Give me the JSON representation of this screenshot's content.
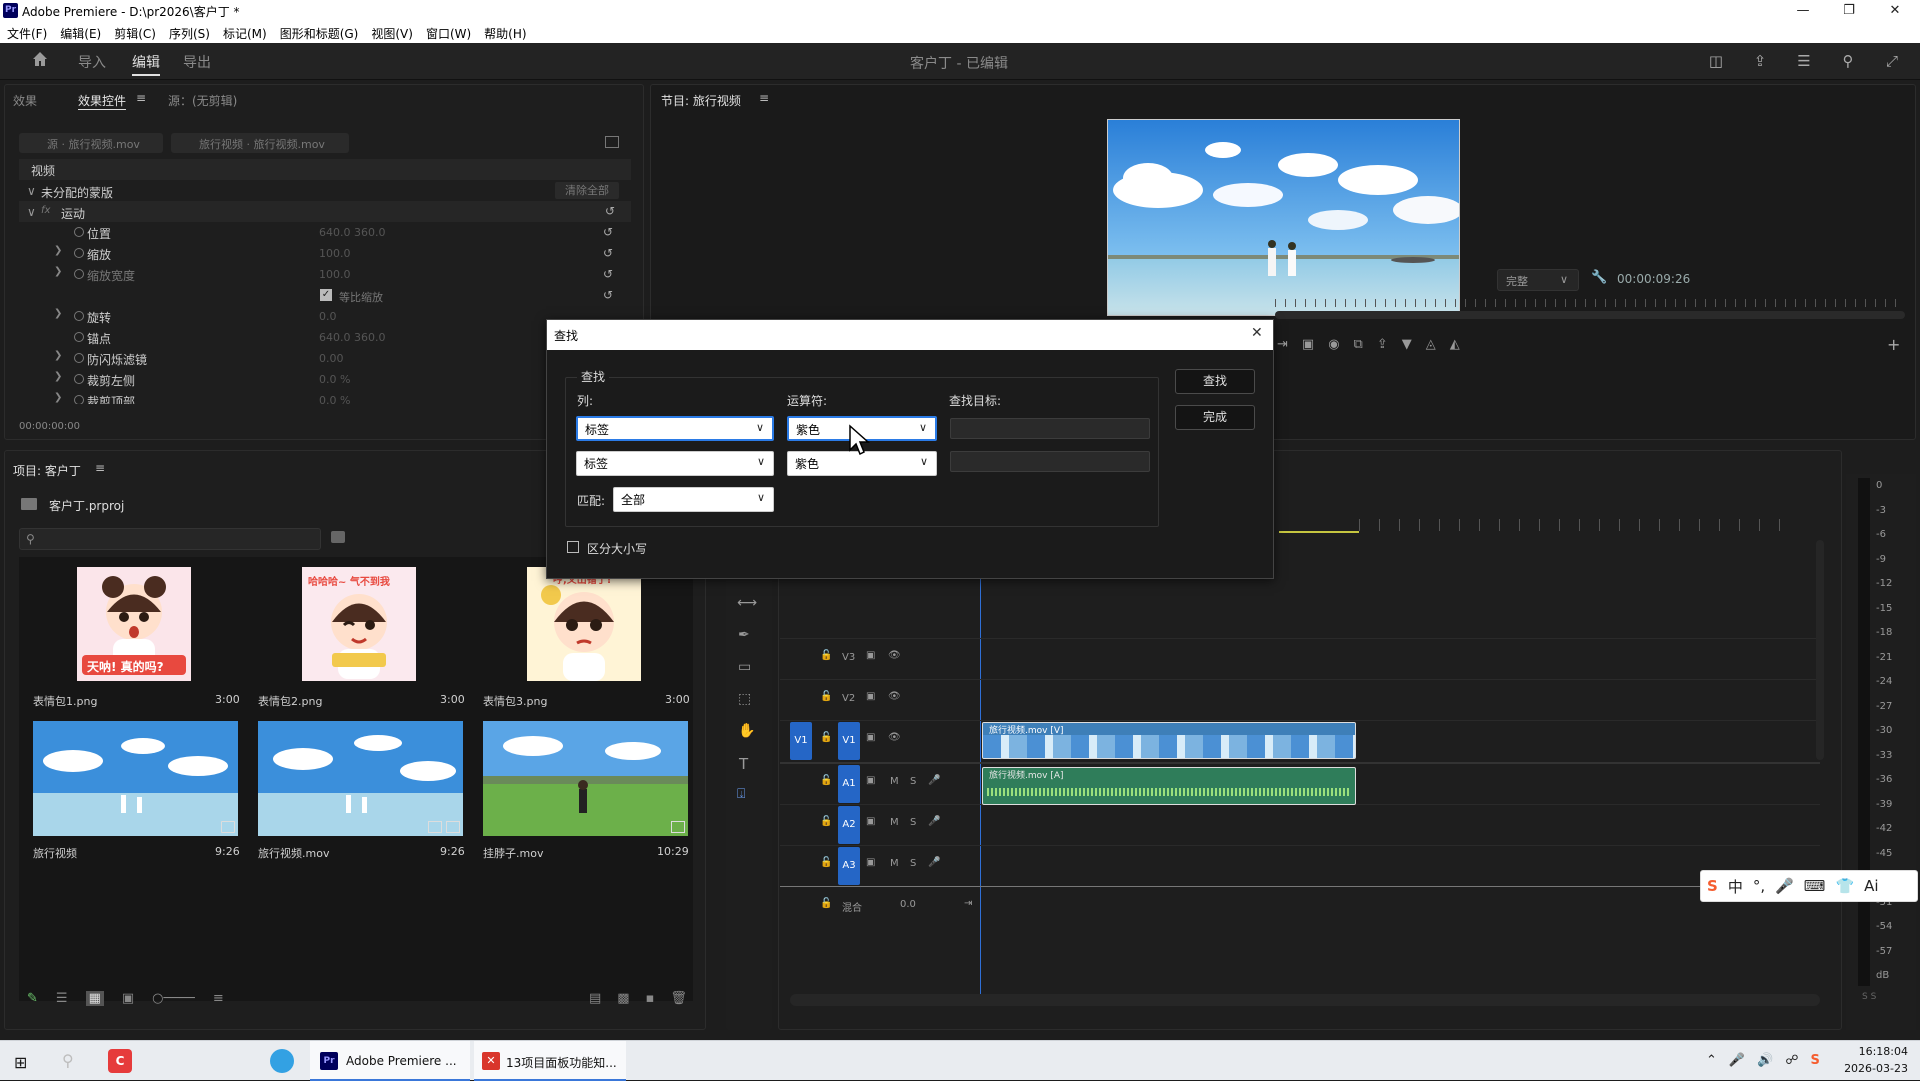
{
  "window": {
    "app_icon": "Pr",
    "title": "Adobe Premiere - D:\\pr2026\\客户丁 *"
  },
  "menu": [
    "文件(F)",
    "编辑(E)",
    "剪辑(C)",
    "序列(S)",
    "标记(M)",
    "图形和标题(G)",
    "视图(V)",
    "窗口(W)",
    "帮助(H)"
  ],
  "workspace": {
    "tabs": [
      "导入",
      "编辑",
      "导出"
    ],
    "active": "编辑",
    "project_status": "客户丁 - 已编辑"
  },
  "effect_controls": {
    "tabs": [
      "效果",
      "效果控件",
      "源：(无剪辑)"
    ],
    "menu_icon": "≡",
    "source_chip": "源 · 旅行视频.mov",
    "sequence_chip": "旅行视频 · 旅行视频.mov",
    "section": "视频",
    "mask_label": "未分配的蒙版",
    "clear_all": "清除全部",
    "motion": "运动",
    "props": [
      {
        "name": "位置",
        "value": "640.0    360.0"
      },
      {
        "name": "缩放",
        "value": "100.0"
      },
      {
        "name": "缩放宽度",
        "value": "100.0"
      },
      {
        "name": "等比缩放",
        "value": ""
      },
      {
        "name": "旋转",
        "value": "0.0"
      },
      {
        "name": "锚点",
        "value": "640.0    360.0"
      },
      {
        "name": "防闪烁滤镜",
        "value": "0.00"
      },
      {
        "name": "裁剪左侧",
        "value": "0.0 %"
      },
      {
        "name": "裁剪顶部",
        "value": "0.0 %"
      }
    ],
    "timecode": "00:00:00:00"
  },
  "program": {
    "title": "节目: 旅行视频",
    "quality": "完整",
    "timecode": "00:00:09:26"
  },
  "find_dialog": {
    "title": "查找",
    "group_label": "查找",
    "col_label": "列:",
    "op_label": "运算符:",
    "target_label": "查找目标:",
    "col1": "标签",
    "op1": "紫色",
    "col2": "标签",
    "op2": "紫色",
    "match_label": "匹配:",
    "match": "全部",
    "case_label": "区分大小写",
    "find_btn": "查找",
    "done_btn": "完成"
  },
  "project": {
    "title": "项目: 客户丁",
    "file": "客户丁.prproj",
    "items": [
      {
        "name": "表情包1.png",
        "dur": "3:00",
        "caption": "天呐! 真的吗?"
      },
      {
        "name": "表情包2.png",
        "dur": "3:00",
        "caption": "哈哈哈~ 气不到我"
      },
      {
        "name": "表情包3.png",
        "dur": "3:00",
        "caption": "哼,又出错了!"
      },
      {
        "name": "旅行视频",
        "dur": "9:26"
      },
      {
        "name": "旅行视频.mov",
        "dur": "9:26"
      },
      {
        "name": "挂脖子.mov",
        "dur": "10:29"
      }
    ]
  },
  "timeline": {
    "tracks_video": [
      "V3",
      "V2",
      "V1"
    ],
    "tracks_audio": [
      "A1",
      "A2",
      "A3"
    ],
    "mix_label": "混合",
    "mix_value": "0.0",
    "video_clip": "旅行视频.mov [V]",
    "audio_clip": "旅行视频.mov [A]",
    "ms": [
      "M",
      "S"
    ]
  },
  "meter": {
    "db": [
      "0",
      "-3",
      "-6",
      "-9",
      "-12",
      "-15",
      "-18",
      "-21",
      "-24",
      "-27",
      "-30",
      "-33",
      "-36",
      "-39",
      "-42",
      "-45",
      "-48",
      "-51",
      "-54",
      "-57",
      "dB"
    ],
    "solo": "S S"
  },
  "ime": {
    "lang": "中",
    "ai": "Ai"
  },
  "taskbar": {
    "apps": [
      {
        "label": "Adobe Premiere ..."
      },
      {
        "label": "13项目面板功能知..."
      }
    ],
    "time": "16:18:04",
    "date": "2026-03-23"
  }
}
